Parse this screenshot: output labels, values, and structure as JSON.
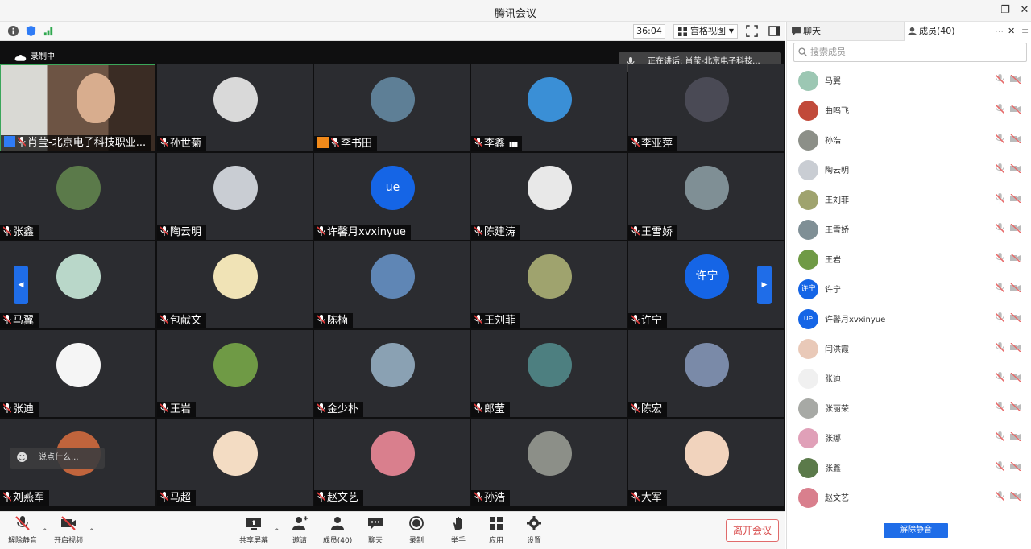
{
  "window": {
    "title": "腾讯会议"
  },
  "toolbar": {
    "timer": "36:04",
    "view_mode": "宫格视图"
  },
  "stage": {
    "recording_label": "录制中",
    "speaking_label": "正在讲话: 肖莹-北京电子科技...",
    "chat_placeholder": "说点什么..."
  },
  "tiles": [
    {
      "name": "肖莹-北京电子科技职业...",
      "avatar_color": "#7a5a46",
      "has_video": true
    },
    {
      "name": "孙世菊",
      "avatar_color": "#d9d9d9"
    },
    {
      "name": "李书田",
      "avatar_color": "#5e7f96"
    },
    {
      "name": "李鑫",
      "avatar_color": "#3a8fd6",
      "signal": "▮▮▮"
    },
    {
      "name": "李亚萍",
      "avatar_color": "#4a4a55"
    },
    {
      "name": "张鑫",
      "avatar_color": "#5b7a4a"
    },
    {
      "name": "陶云明",
      "avatar_color": "#c9cdd3"
    },
    {
      "name": "许馨月xvxinyue",
      "avatar_color": "#1565e6",
      "avatar_text": "ue"
    },
    {
      "name": "陈建涛",
      "avatar_color": "#e8e8e8"
    },
    {
      "name": "王雪娇",
      "avatar_color": "#7f8f95"
    },
    {
      "name": "马翼",
      "avatar_color": "#b9d7c9"
    },
    {
      "name": "包献文",
      "avatar_color": "#f0e3b6"
    },
    {
      "name": "陈楠",
      "avatar_color": "#5f86b5"
    },
    {
      "name": "王刘菲",
      "avatar_color": "#9fa36e"
    },
    {
      "name": "许宁",
      "avatar_color": "#1565e6",
      "avatar_text": "许宁"
    },
    {
      "name": "张迪",
      "avatar_color": "#f5f5f5"
    },
    {
      "name": "王岩",
      "avatar_color": "#6f9a45"
    },
    {
      "name": "金少朴",
      "avatar_color": "#8aa1b3"
    },
    {
      "name": "郎莹",
      "avatar_color": "#4d7f80"
    },
    {
      "name": "陈宏",
      "avatar_color": "#7a8aa8"
    },
    {
      "name": "刘燕军",
      "avatar_color": "#c0643c"
    },
    {
      "name": "马超",
      "avatar_color": "#f3dcc3"
    },
    {
      "name": "赵文艺",
      "avatar_color": "#d97f8d"
    },
    {
      "name": "孙浩",
      "avatar_color": "#8c8f88"
    },
    {
      "name": "大军",
      "avatar_color": "#f1d3bd"
    }
  ],
  "controls": {
    "unmute": "解除静音",
    "video": "开启视频",
    "share": "共享屏幕",
    "invite": "邀请",
    "members": "成员(40)",
    "chat": "聊天",
    "record": "录制",
    "raise_hand": "举手",
    "apps": "应用",
    "settings": "设置",
    "leave": "离开会议"
  },
  "panel": {
    "tab_chat": "聊天",
    "tab_members": "成员(40)",
    "search_placeholder": "搜索成员",
    "unmute_all": "解除静音",
    "members": [
      {
        "name": "马翼",
        "color": "#9cc7b3"
      },
      {
        "name": "曲鸣飞",
        "color": "#c14a3a"
      },
      {
        "name": "孙浩",
        "color": "#8c8f88"
      },
      {
        "name": "陶云明",
        "color": "#c9cdd3"
      },
      {
        "name": "王刘菲",
        "color": "#9fa36e"
      },
      {
        "name": "王雪娇",
        "color": "#7f8f95"
      },
      {
        "name": "王岩",
        "color": "#6f9a45"
      },
      {
        "name": "许宁",
        "color": "#1565e6",
        "text": "许宁"
      },
      {
        "name": "许馨月xvxinyue",
        "color": "#1565e6",
        "text": "ue"
      },
      {
        "name": "闫洪霞",
        "color": "#e9c9b8"
      },
      {
        "name": "张迪",
        "color": "#f0f0f0"
      },
      {
        "name": "张丽荣",
        "color": "#a7a9a5"
      },
      {
        "name": "张娜",
        "color": "#e0a0b8"
      },
      {
        "name": "张鑫",
        "color": "#5b7a4a"
      },
      {
        "name": "赵文艺",
        "color": "#d97f8d"
      }
    ]
  }
}
